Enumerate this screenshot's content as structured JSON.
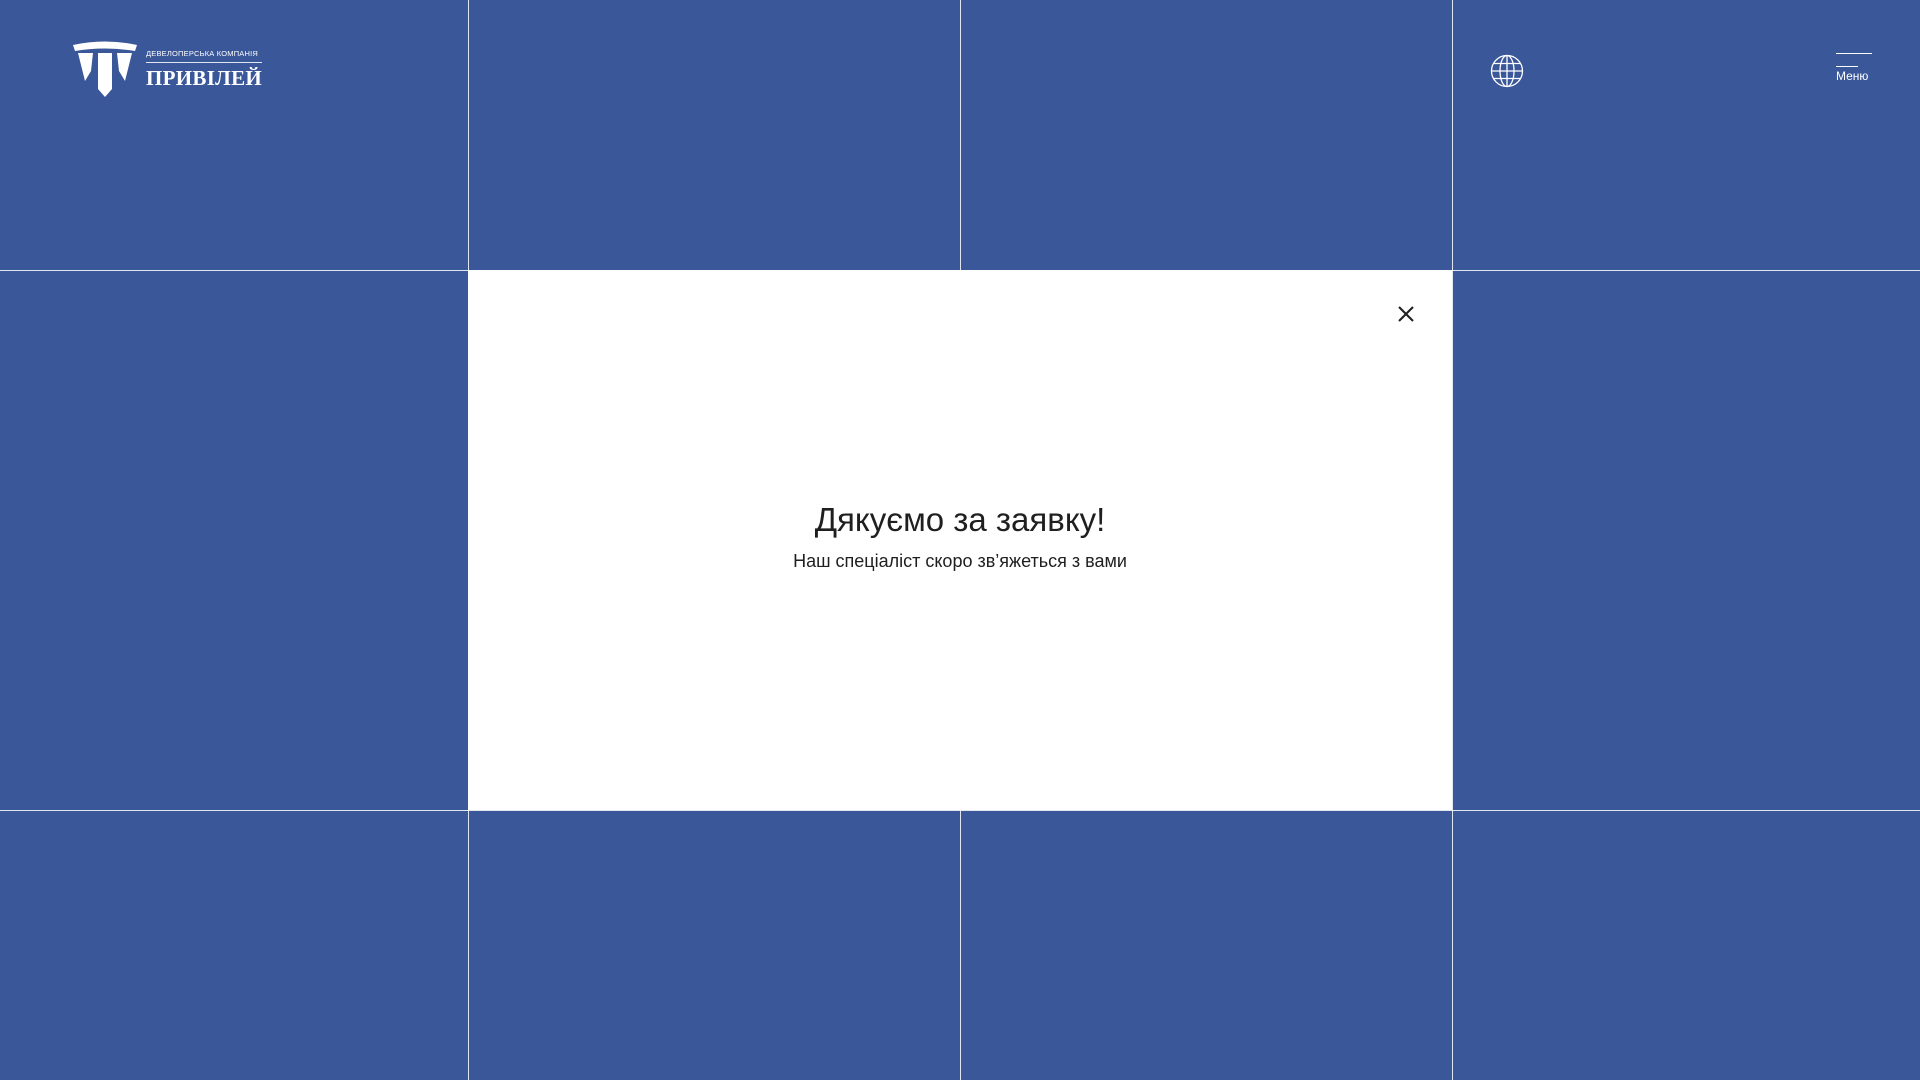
{
  "header": {
    "logo": {
      "company_type": "ДЕВЕЛОПЕРСЬКА КОМПАНІЯ",
      "company_name": "ПРИВІЛЕЙ"
    },
    "language_icon": "globe-icon",
    "menu": {
      "label": "Меню",
      "icon": "hamburger-menu-icon"
    }
  },
  "modal": {
    "title": "Дякуємо за заявку!",
    "subtitle": "Наш спеціаліст скоро зв’яжеться з вами",
    "close_icon": "close-icon"
  },
  "colors": {
    "background": "#3a5799",
    "modal_background": "#ffffff",
    "text": "#1f1f1f",
    "lines": "#ffffff"
  }
}
